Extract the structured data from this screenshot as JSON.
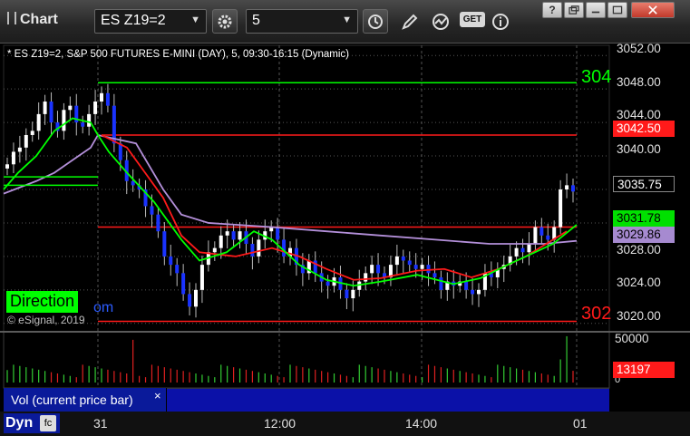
{
  "toolbar": {
    "title": "Chart",
    "symbol": "ES Z19=2",
    "interval": "5",
    "get_badge": "GET",
    "window_controls": [
      "help-icon",
      "restore-icon",
      "maximize-icon",
      "close-icon"
    ]
  },
  "chart": {
    "header": "* ES Z19=2, S&P 500 FUTURES E-MINI (DAY), 5, 09:30-16:15 (Dynamic)",
    "direction_label": "Direction",
    "direction_suffix": "om",
    "copyright": "© eSignal, 2019",
    "price_axis": [
      "3052.00",
      "3048.00",
      "3044.00",
      "3040.00",
      "3028.00",
      "3024.00",
      "3020.00"
    ],
    "price_boxes": {
      "red_line": "3042.50",
      "last": "3035.75",
      "green_ma": "3031.78",
      "purple_ma": "3029.86"
    },
    "right_line_labels": {
      "top_green": "304",
      "bottom_red": "302"
    },
    "colors": {
      "up_candle": "#ffffff",
      "down_candle": "#1a33ff",
      "green_ma": "#00ff00",
      "red_ma": "#ff1a1a",
      "purple_ma": "#b38fd9",
      "level_red": "#ff1a1a",
      "level_green": "#00ff00"
    }
  },
  "chart_data": {
    "type": "candlestick",
    "symbol": "ES Z19=2",
    "interval": "5",
    "ylim": [
      3019,
      3053
    ],
    "horizontal_levels": [
      {
        "value": 3048.75,
        "color": "green"
      },
      {
        "value": 3042.5,
        "color": "red"
      },
      {
        "value": 3031.5,
        "color": "red"
      },
      {
        "value": 3020.25,
        "color": "red"
      }
    ],
    "time_labels": [
      "31",
      "12:00",
      "14:00",
      "01"
    ],
    "volume_axis": [
      "50000",
      "0"
    ],
    "volume_last": "13197"
  },
  "volume_panel": {
    "label": "Vol (current price bar)",
    "close": "×",
    "axis_top": "50000",
    "axis_bottom": "0",
    "last_value": "13197"
  },
  "bottom_bar": {
    "mode": "Dyn",
    "icon": "fc",
    "ticks": [
      "31",
      "12:00",
      "14:00",
      "01"
    ]
  }
}
